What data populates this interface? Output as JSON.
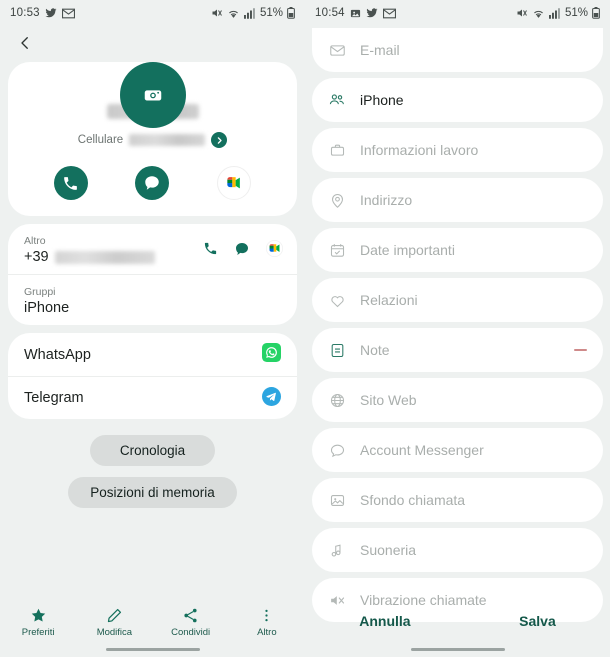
{
  "left": {
    "status": {
      "time": "10:53",
      "battery": "51%",
      "icons": [
        "twitter-icon",
        "gmail-icon"
      ],
      "right_icons": [
        "mute-icon",
        "wifi-icon",
        "signal-icon",
        "battery-icon"
      ]
    },
    "back_button": "back-chevron",
    "avatar": {
      "icon": "camera-icon",
      "color": "#13705e"
    },
    "contact": {
      "name_redacted": true,
      "phone_label": "Cellulare",
      "phone_redacted": true,
      "expand_icon": "chevron-right-badge"
    },
    "actions": [
      {
        "name": "call-action",
        "icon": "phone-icon"
      },
      {
        "name": "message-action",
        "icon": "chat-bubble-icon"
      },
      {
        "name": "meet-action",
        "icon": "google-meet-icon"
      }
    ],
    "details": [
      {
        "label": "Altro",
        "value_prefix": "+39",
        "value_redacted": true,
        "icons": [
          "phone-icon",
          "chat-bubble-icon",
          "google-meet-icon"
        ]
      },
      {
        "label": "Gruppi",
        "value": "iPhone"
      }
    ],
    "apps": [
      {
        "label": "WhatsApp",
        "icon": "whatsapp-icon"
      },
      {
        "label": "Telegram",
        "icon": "telegram-icon"
      }
    ],
    "pills": [
      {
        "label": "Cronologia"
      },
      {
        "label": "Posizioni di memoria"
      }
    ],
    "bottom_nav": [
      {
        "label": "Preferiti",
        "icon": "star-icon"
      },
      {
        "label": "Modifica",
        "icon": "pencil-icon"
      },
      {
        "label": "Condividi",
        "icon": "share-icon"
      },
      {
        "label": "Altro",
        "icon": "more-vertical-icon"
      }
    ]
  },
  "right": {
    "status": {
      "time": "10:54",
      "battery": "51%"
    },
    "rows": [
      {
        "label": "E-mail",
        "icon": "envelope-icon",
        "active": false,
        "minus": false
      },
      {
        "label": "iPhone",
        "icon": "group-people-icon",
        "active": true,
        "minus": false
      },
      {
        "label": "Informazioni lavoro",
        "icon": "briefcase-icon",
        "active": false,
        "minus": false
      },
      {
        "label": "Indirizzo",
        "icon": "location-pin-icon",
        "active": false,
        "minus": false
      },
      {
        "label": "Date importanti",
        "icon": "calendar-check-icon",
        "active": false,
        "minus": false
      },
      {
        "label": "Relazioni",
        "icon": "relations-icon",
        "active": false,
        "minus": false
      },
      {
        "label": "Note",
        "icon": "note-icon",
        "active": false,
        "minus": true
      },
      {
        "label": "Sito Web",
        "icon": "globe-icon",
        "active": false,
        "minus": false
      },
      {
        "label": "Account Messenger",
        "icon": "speech-bubble-icon",
        "active": false,
        "minus": false
      },
      {
        "label": "Sfondo chiamata",
        "icon": "image-icon",
        "active": false,
        "minus": false
      },
      {
        "label": "Suoneria",
        "icon": "music-note-icon",
        "active": false,
        "minus": false
      },
      {
        "label": "Vibrazione chiamate",
        "icon": "vibration-icon",
        "active": false,
        "minus": false
      }
    ],
    "footer": {
      "cancel": "Annulla",
      "save": "Salva"
    }
  },
  "colors": {
    "accent": "#13705e",
    "footer_text": "#14584a",
    "bg": "#eef1f0",
    "card": "#ffffff",
    "muted_text": "#a9aeac",
    "minus": "#cf8a8a"
  }
}
